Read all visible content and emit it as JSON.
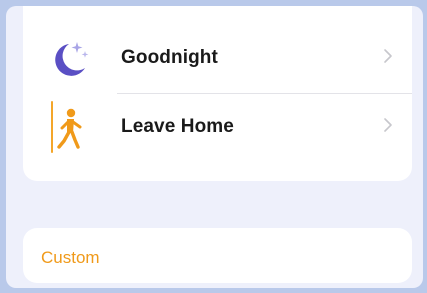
{
  "shortcuts": {
    "items": [
      {
        "label": "Goodnight",
        "icon": "moon-stars-icon"
      },
      {
        "label": "Leave Home",
        "icon": "walking-person-icon"
      }
    ]
  },
  "custom": {
    "label": "Custom"
  },
  "colors": {
    "frame": "#b9c9ea",
    "background": "#eef0fb",
    "card": "#ffffff",
    "moon": "#5a4fc4",
    "accent": "#f09a1a"
  }
}
